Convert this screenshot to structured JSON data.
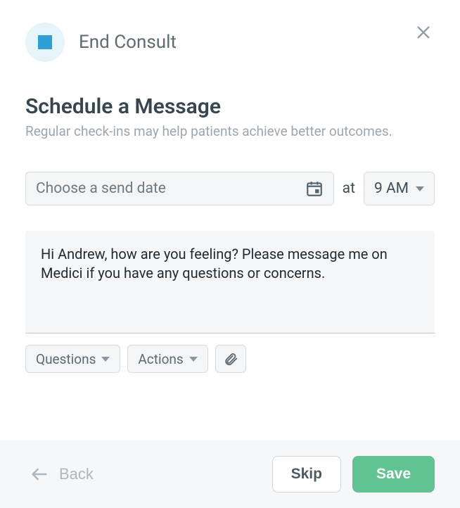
{
  "header": {
    "title": "End Consult"
  },
  "page": {
    "title": "Schedule a Message",
    "subtitle": "Regular check-ins may help patients achieve better outcomes."
  },
  "date": {
    "placeholder": "Choose a send date",
    "at_label": "at",
    "time_value": "9 AM"
  },
  "message": {
    "value": "Hi Andrew, how are you feeling? Please message me on Medici if you have any questions or concerns."
  },
  "toolbar": {
    "questions_label": "Questions",
    "actions_label": "Actions"
  },
  "footer": {
    "back_label": "Back",
    "skip_label": "Skip",
    "save_label": "Save"
  },
  "colors": {
    "accent_green": "#5fc491",
    "accent_blue": "#2f9fd8"
  }
}
